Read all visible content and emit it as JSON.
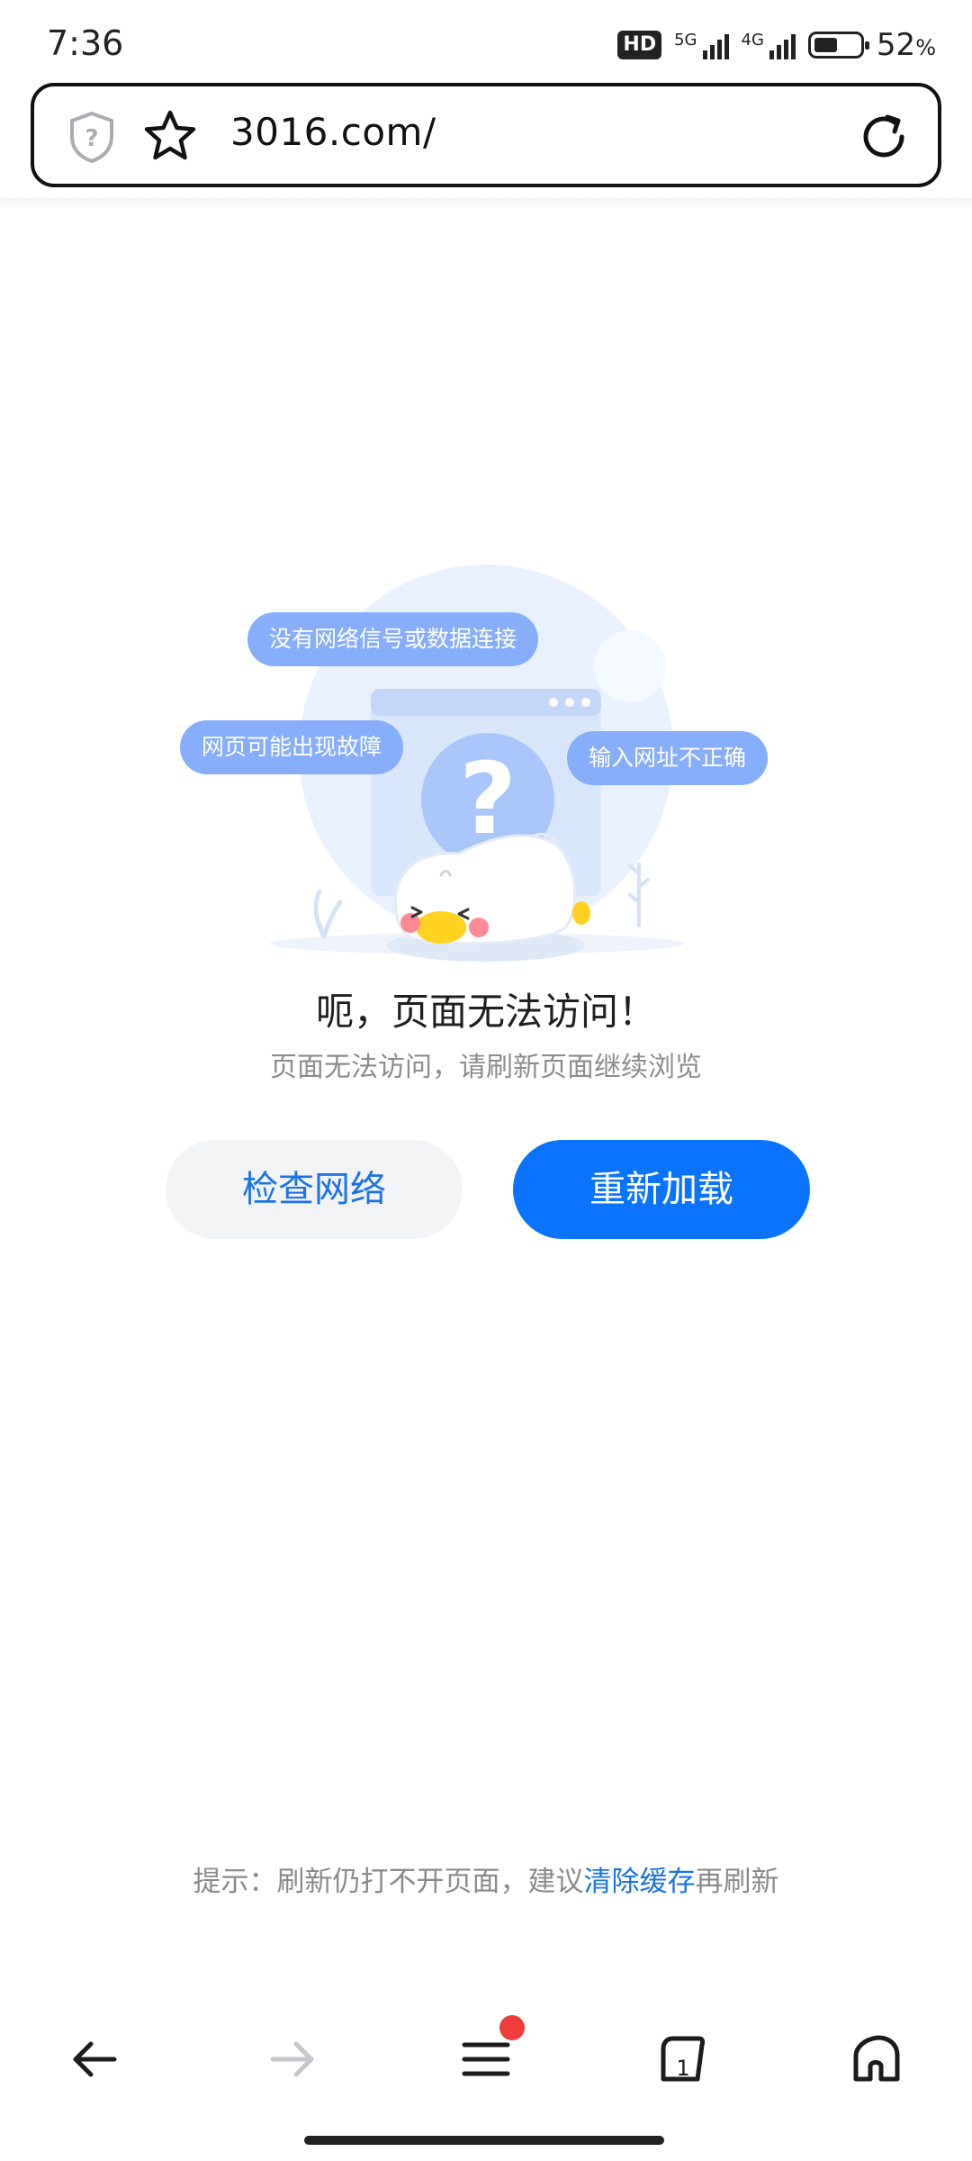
{
  "status_bar": {
    "time": "7:36",
    "hd_badge": "HD",
    "net1_label": "5G",
    "net2_label": "4G",
    "battery_level": 0.52,
    "battery_percent": "52",
    "battery_unit": "%"
  },
  "url_bar": {
    "url": "3016.com/",
    "shield_icon": "shield-question-icon",
    "bookmark_icon": "star-outline-icon",
    "reload_icon": "reload-icon"
  },
  "illustration": {
    "bubbles": [
      "没有网络信号或数据连接",
      "网页可能出现故障",
      "输入网址不正确"
    ]
  },
  "error": {
    "title": "呃，页面无法访问！",
    "subtitle": "页面无法访问，请刷新页面继续浏览"
  },
  "buttons": {
    "check_network": "检查网络",
    "reload": "重新加载"
  },
  "hint": {
    "prefix": "提示：刷新仍打不开页面，建议",
    "link": "清除缓存",
    "suffix": "再刷新"
  },
  "bottom_nav": {
    "tab_count": "1",
    "back_icon": "arrow-left-icon",
    "forward_icon": "arrow-right-icon",
    "menu_icon": "hamburger-menu-icon",
    "tabs_icon": "tabs-icon",
    "home_icon": "home-icon"
  },
  "colors": {
    "accent": "#0a74ff",
    "link": "#1a73e8",
    "bubble": "#87aefb",
    "badge_dot": "#f03b3b"
  }
}
